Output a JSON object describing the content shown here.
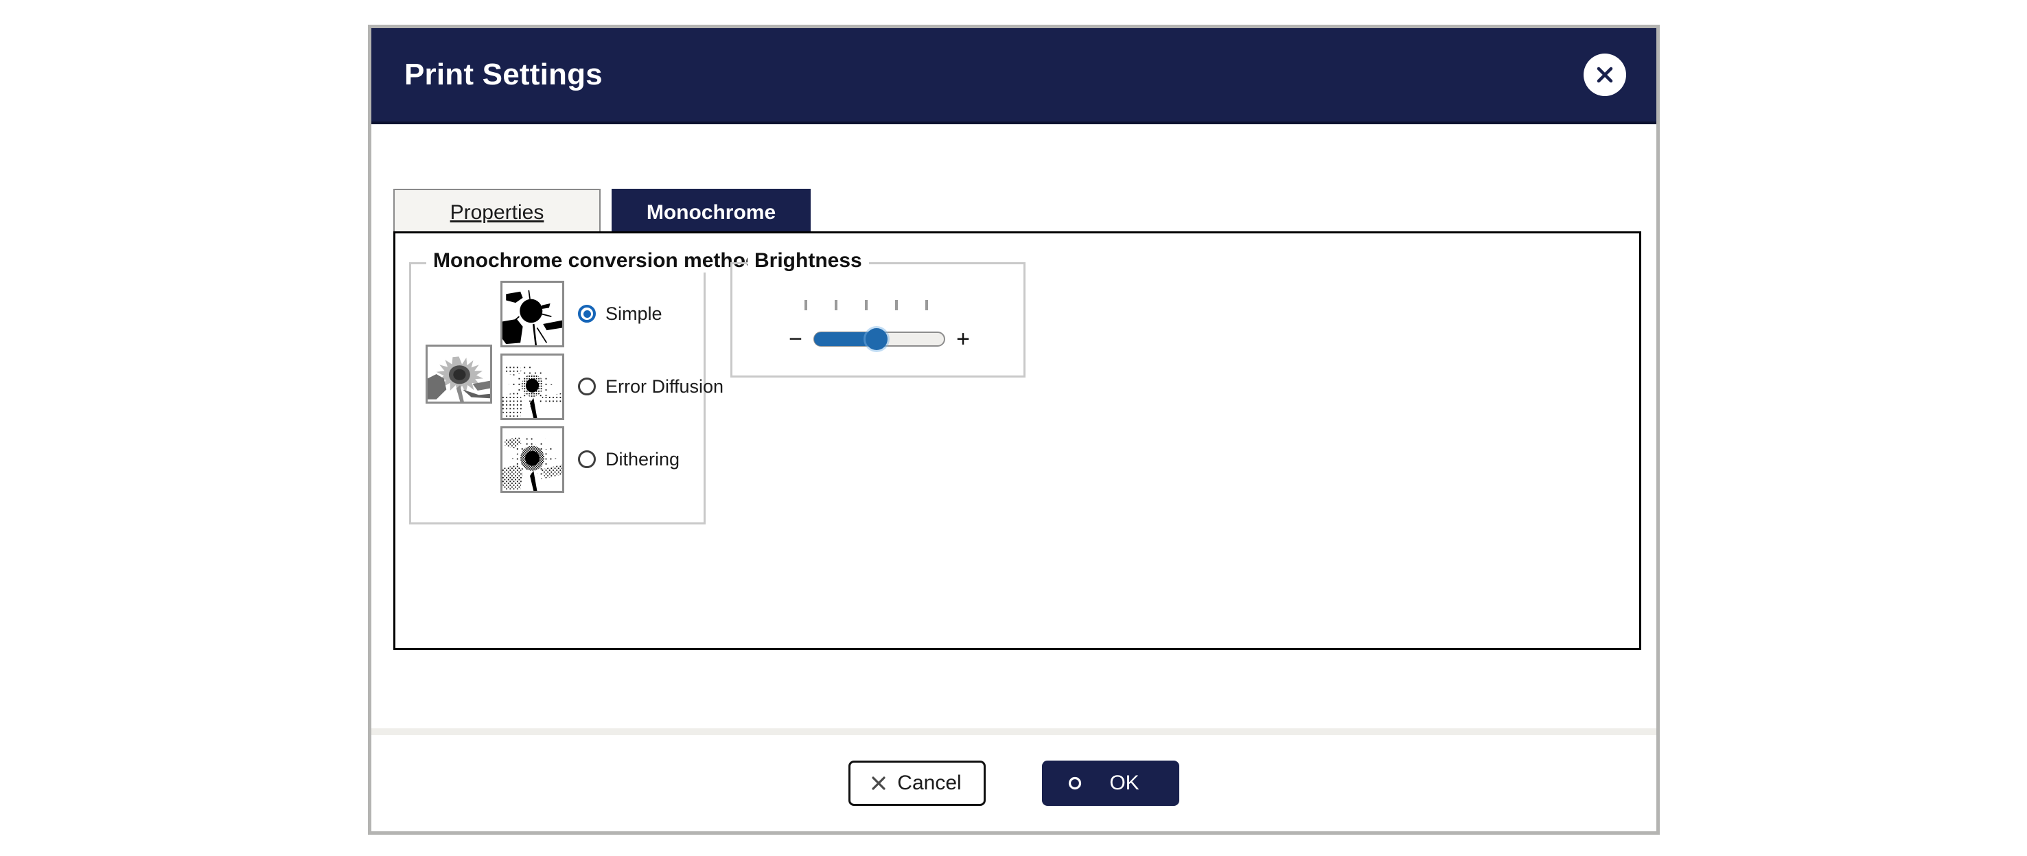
{
  "dialog": {
    "title": "Print Settings",
    "close_icon": "close-x-icon"
  },
  "tabs": [
    {
      "label": "Properties",
      "active": false
    },
    {
      "label": "Monochrome",
      "active": true
    }
  ],
  "monochrome_group": {
    "legend": "Monochrome conversion method",
    "source_preview_alt": "sunflower-grayscale-preview",
    "options": [
      {
        "label": "Simple",
        "selected": true,
        "preview_alt": "sunflower-threshold-preview"
      },
      {
        "label": "Error Diffusion",
        "selected": false,
        "preview_alt": "sunflower-error-diffusion-preview"
      },
      {
        "label": "Dithering",
        "selected": false,
        "preview_alt": "sunflower-dithering-preview"
      }
    ]
  },
  "brightness_group": {
    "legend": "Brightness",
    "decrease_label": "−",
    "increase_label": "+",
    "value_percent": 48,
    "min": 0,
    "max": 100,
    "tick_count": 5
  },
  "footer": {
    "cancel_label": "Cancel",
    "cancel_icon": "x-icon",
    "ok_label": "OK",
    "ok_icon": "circle-icon"
  },
  "colors": {
    "titlebar": "#18204c",
    "accent_blue": "#1f69ad",
    "radio_blue": "#1565b8",
    "dialog_border": "#b4b4b2",
    "panel_border": "#000000",
    "group_border": "#c9c9c9"
  }
}
